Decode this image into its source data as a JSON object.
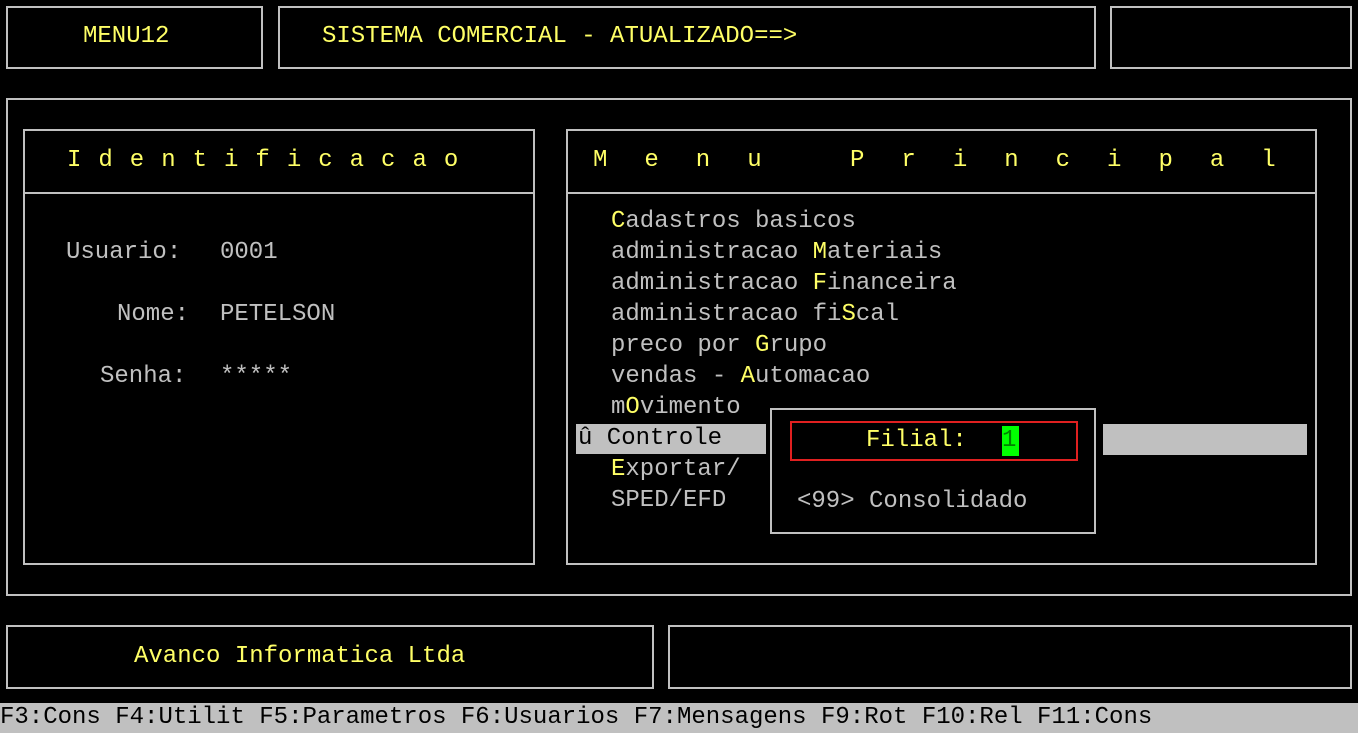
{
  "header": {
    "menu_id": "MENU12",
    "system_title": "SISTEMA COMERCIAL - ATUALIZADO==>",
    "right_box": ""
  },
  "identificacao": {
    "title": "I d e n t i f i c a c a o",
    "usuario_label": "Usuario:",
    "usuario_value": "0001",
    "nome_label": "Nome:",
    "nome_value": "PETELSON",
    "senha_label": "Senha:",
    "senha_value": "*****"
  },
  "menu_principal": {
    "title": "M e n u   P r i n c i p a l",
    "items": [
      {
        "pre": "",
        "hot": "C",
        "post": "adastros basicos"
      },
      {
        "pre": "administracao ",
        "hot": "M",
        "post": "ateriais"
      },
      {
        "pre": "administracao ",
        "hot": "F",
        "post": "inanceira"
      },
      {
        "pre": "administracao fi",
        "hot": "S",
        "post": "cal"
      },
      {
        "pre": "preco por ",
        "hot": "G",
        "post": "rupo"
      },
      {
        "pre": "vendas - ",
        "hot": "A",
        "post": "utomacao"
      },
      {
        "pre": "m",
        "hot": "O",
        "post": "vimento"
      },
      {
        "pre": "û Controle",
        "hot": "",
        "post": ""
      },
      {
        "pre": "",
        "hot": "E",
        "post": "xportar/"
      },
      {
        "pre": "SPED/EFD",
        "hot": "",
        "post": ""
      }
    ],
    "selected_index": 7
  },
  "filial_dialog": {
    "label": "Filial:",
    "value": "1",
    "hint": "<99> Consolidado"
  },
  "footer": {
    "company": "Avanco Informatica Ltda",
    "right_box": ""
  },
  "function_keys": [
    "F3:Cons",
    "F4:Utilit",
    "F5:Parametros",
    "F6:Usuarios",
    "F7:Mensagens",
    "F9:Rot",
    "F10:Rel",
    "F11:Cons"
  ],
  "colors": {
    "background": "#000000",
    "text": "#c0c0c0",
    "highlight": "#ffff66",
    "cursor": "#00ff00",
    "dialog_border": "#e02020",
    "selection_bar": "#c0c0c0"
  }
}
